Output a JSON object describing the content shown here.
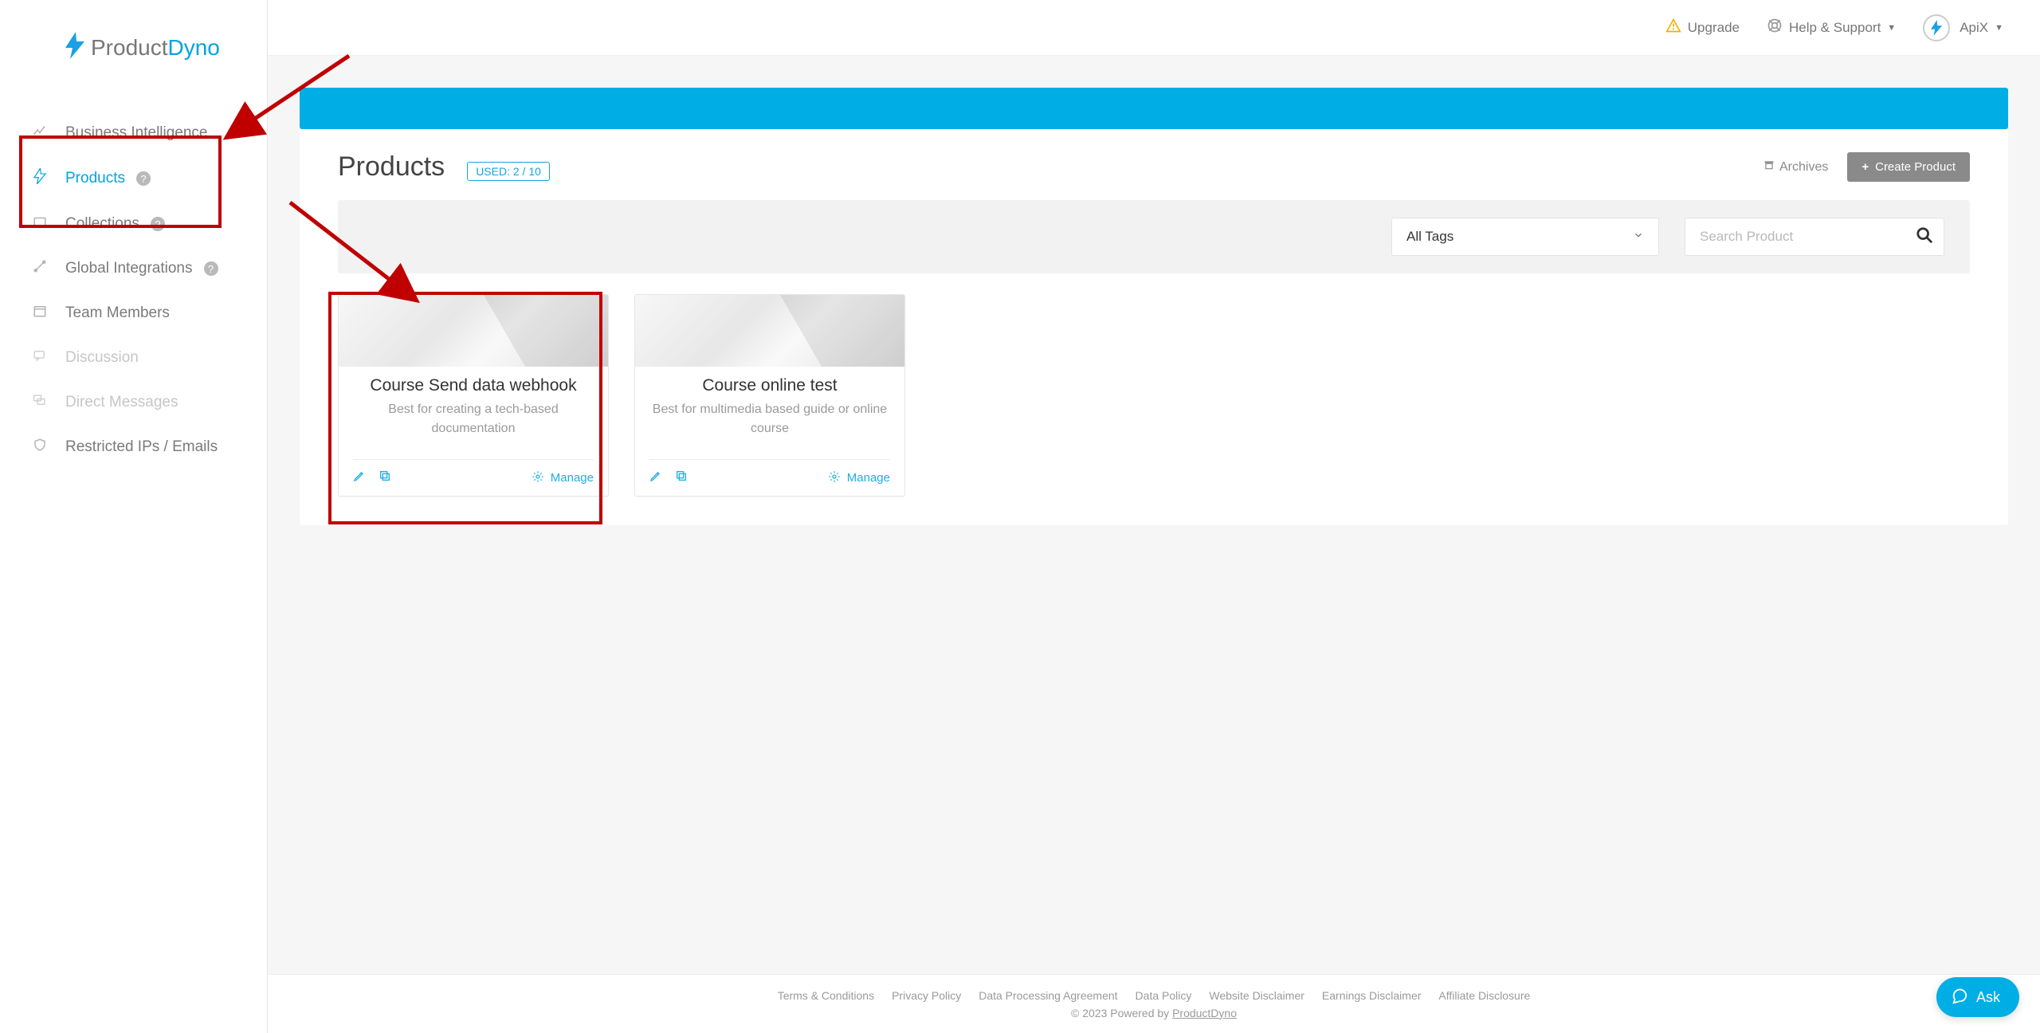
{
  "brand": {
    "name1": "Product",
    "name2": "Dyno"
  },
  "sidebar": {
    "items": [
      {
        "label": "Business Intelligence",
        "icon": "chart-line-icon",
        "active": false,
        "help": false,
        "faded": false
      },
      {
        "label": "Products",
        "icon": "bolt-icon",
        "active": true,
        "help": true,
        "faded": false
      },
      {
        "label": "Collections",
        "icon": "folder-icon",
        "active": false,
        "help": true,
        "faded": false
      },
      {
        "label": "Global Integrations",
        "icon": "tools-icon",
        "active": false,
        "help": true,
        "faded": false
      },
      {
        "label": "Team Members",
        "icon": "calendar-icon",
        "active": false,
        "help": false,
        "faded": false
      },
      {
        "label": "Discussion",
        "icon": "chat-icon",
        "active": false,
        "help": false,
        "faded": true
      },
      {
        "label": "Direct Messages",
        "icon": "messages-icon",
        "active": false,
        "help": false,
        "faded": true
      },
      {
        "label": "Restricted IPs / Emails",
        "icon": "shield-icon",
        "active": false,
        "help": false,
        "faded": false
      }
    ]
  },
  "topbar": {
    "upgrade": {
      "label": "Upgrade"
    },
    "help": {
      "label": "Help & Support"
    },
    "user": {
      "name": "ApiX"
    }
  },
  "page": {
    "title": "Products",
    "usage_badge": "USED: 2 / 10",
    "archives_label": "Archives",
    "create_button": "Create Product"
  },
  "filters": {
    "tags_selected": "All Tags",
    "search_placeholder": "Search Product"
  },
  "products": [
    {
      "title": "Course Send data webhook",
      "desc": "Best for creating a tech-based documentation",
      "manage": "Manage"
    },
    {
      "title": "Course online test",
      "desc": "Best for multimedia based guide or online course",
      "manage": "Manage"
    }
  ],
  "footer": {
    "links": [
      "Terms & Conditions",
      "Privacy Policy",
      "Data Processing Agreement",
      "Data Policy",
      "Website Disclaimer",
      "Earnings Disclaimer",
      "Affiliate Disclosure"
    ],
    "copyright_prefix": "© 2023 Powered by ",
    "copyright_link": "ProductDyno"
  },
  "ask_widget": {
    "label": "Ask"
  }
}
